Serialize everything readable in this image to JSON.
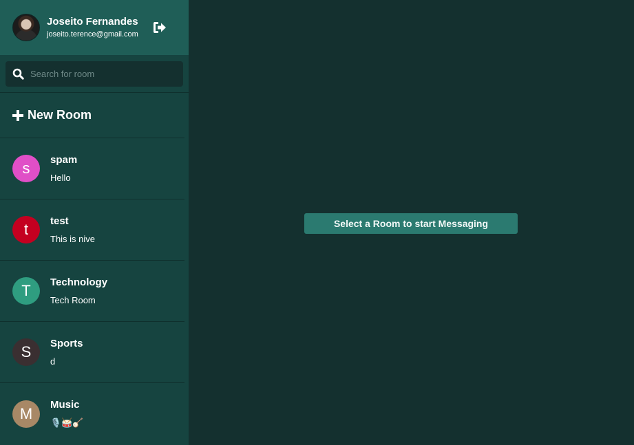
{
  "user": {
    "name": "Joseito Fernandes",
    "email": "joseito.terence@gmail.com",
    "avatar_icon": "user-photo",
    "logout_icon": "sign-out-icon"
  },
  "search": {
    "placeholder": "Search for room",
    "value": ""
  },
  "new_room": {
    "label": "New Room",
    "icon": "plus-icon"
  },
  "rooms": [
    {
      "initial": "s",
      "name": "spam",
      "last_message": "Hello",
      "color": "#e04fc7"
    },
    {
      "initial": "t",
      "name": "test",
      "last_message": "This is nive",
      "color": "#c40020"
    },
    {
      "initial": "T",
      "name": "Technology",
      "last_message": "Tech Room",
      "color": "#2f9d80"
    },
    {
      "initial": "S",
      "name": "Sports",
      "last_message": "d",
      "color": "#3a2f31"
    },
    {
      "initial": "M",
      "name": "Music",
      "last_message": "🎙️🥁🪕",
      "color": "#a88866"
    }
  ],
  "main": {
    "placeholder_message": "Select a Room to start Messaging"
  },
  "colors": {
    "sidebar": "#164440",
    "profile_header": "#1f5e57",
    "main_background": "#14302f",
    "banner": "#2b7a70"
  }
}
